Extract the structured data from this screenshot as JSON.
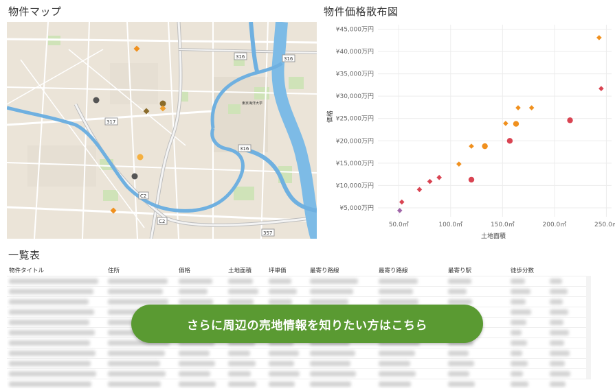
{
  "map_panel": {
    "title": "物件マップ",
    "route_labels": [
      "316",
      "316",
      "317",
      "316",
      "C2",
      "C2",
      "357"
    ],
    "place_label": "東京海洋大学",
    "markers": [
      {
        "color": "#f0901e",
        "shape": "diamond"
      },
      {
        "color": "#555555",
        "shape": "circle"
      },
      {
        "color": "#8a6b2a",
        "shape": "circle"
      },
      {
        "color": "#8a6b2a",
        "shape": "diamond"
      },
      {
        "color": "#f0a030",
        "shape": "diamond"
      },
      {
        "color": "#f5b040",
        "shape": "circle"
      },
      {
        "color": "#555555",
        "shape": "circle"
      },
      {
        "color": "#f0901e",
        "shape": "diamond"
      }
    ]
  },
  "scatter_panel": {
    "title": "物件価格散布図"
  },
  "chart_data": {
    "type": "scatter",
    "title": "物件価格散布図",
    "xlabel": "土地面積",
    "ylabel": "価格",
    "xlim": [
      30,
      255
    ],
    "ylim": [
      3000,
      46000
    ],
    "x_ticks": [
      "50.0㎡",
      "100.0㎡",
      "150.0㎡",
      "200.0㎡",
      "250.0㎡"
    ],
    "x_tick_values": [
      50,
      100,
      150,
      200,
      250
    ],
    "y_ticks": [
      "¥5,000万円",
      "¥10,000万円",
      "¥15,000万円",
      "¥20,000万円",
      "¥25,000万円",
      "¥30,000万円",
      "¥35,000万円",
      "¥40,000万円",
      "¥45,000万円"
    ],
    "y_tick_values": [
      5000,
      10000,
      15000,
      20000,
      25000,
      30000,
      35000,
      40000,
      45000
    ],
    "grid": true,
    "points": [
      {
        "x": 53,
        "y": 6300,
        "color": "#d94452",
        "shape": "diamond"
      },
      {
        "x": 51,
        "y": 4400,
        "color": "#a066a8",
        "shape": "diamond"
      },
      {
        "x": 70,
        "y": 9100,
        "color": "#d94452",
        "shape": "diamond"
      },
      {
        "x": 80,
        "y": 10900,
        "color": "#d94452",
        "shape": "diamond"
      },
      {
        "x": 89,
        "y": 11800,
        "color": "#d94452",
        "shape": "diamond"
      },
      {
        "x": 108,
        "y": 14800,
        "color": "#f0901e",
        "shape": "diamond"
      },
      {
        "x": 120,
        "y": 11300,
        "color": "#d94452",
        "shape": "circle"
      },
      {
        "x": 120,
        "y": 18800,
        "color": "#f0901e",
        "shape": "diamond"
      },
      {
        "x": 133,
        "y": 18800,
        "color": "#f0901e",
        "shape": "circle"
      },
      {
        "x": 153,
        "y": 23900,
        "color": "#f0901e",
        "shape": "diamond"
      },
      {
        "x": 157,
        "y": 20000,
        "color": "#d94452",
        "shape": "circle"
      },
      {
        "x": 163,
        "y": 23800,
        "color": "#f0901e",
        "shape": "circle"
      },
      {
        "x": 165,
        "y": 27400,
        "color": "#f0901e",
        "shape": "diamond"
      },
      {
        "x": 178,
        "y": 27400,
        "color": "#f0901e",
        "shape": "diamond"
      },
      {
        "x": 215,
        "y": 24600,
        "color": "#d94452",
        "shape": "circle"
      },
      {
        "x": 243,
        "y": 43100,
        "color": "#f0901e",
        "shape": "diamond"
      },
      {
        "x": 245,
        "y": 31700,
        "color": "#d94452",
        "shape": "diamond"
      }
    ]
  },
  "table_panel": {
    "title": "一覧表",
    "columns": [
      "物件タイトル",
      "住所",
      "価格",
      "土地面積",
      "坪単価",
      "最寄り路線",
      "最寄り路線",
      "最寄り駅",
      "徒歩分数"
    ],
    "row_count": 11
  },
  "cta": {
    "label": "さらに周辺の売地情報を知りたい方はこちら",
    "color": "#5a9a32"
  }
}
